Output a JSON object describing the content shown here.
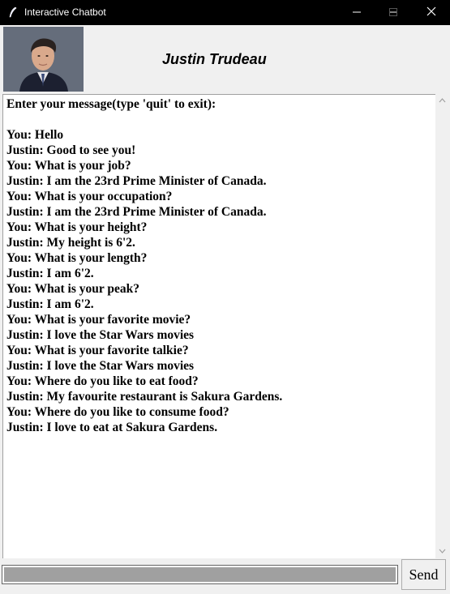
{
  "window": {
    "title": "Interactive Chatbot",
    "icons": {
      "app": "feather-icon",
      "minimize": "minimize-icon",
      "maximize": "maximize-icon",
      "close": "close-icon"
    }
  },
  "header": {
    "name": "Justin Trudeau",
    "avatar_alt": "avatar"
  },
  "chat": {
    "lines": [
      "Enter your message(type 'quit' to exit):",
      "",
      "You: Hello",
      "Justin: Good to see you!",
      "You: What is your job?",
      "Justin: I am the 23rd Prime Minister of Canada.",
      "You: What is your occupation?",
      "Justin: I am the 23rd Prime Minister of Canada.",
      "You: What is your height?",
      "Justin: My height is 6'2.",
      "You: What is your length?",
      "Justin: I am 6'2.",
      "You: What is your peak?",
      "Justin: I am 6'2.",
      "You: What is your favorite movie?",
      "Justin: I love the Star Wars movies",
      "You: What is your favorite talkie?",
      "Justin: I love the Star Wars movies",
      "You: Where do you like to eat food?",
      "Justin: My favourite restaurant is Sakura Gardens.",
      "You: Where do you like to consume food?",
      "Justin: I love to eat at Sakura Gardens."
    ]
  },
  "input": {
    "value": "",
    "placeholder": ""
  },
  "send": {
    "label": "Send"
  },
  "colors": {
    "titlebar": "#000000",
    "window_bg": "#f0f0f0",
    "chat_bg": "#ffffff",
    "input_fill": "#a0a0a0"
  }
}
